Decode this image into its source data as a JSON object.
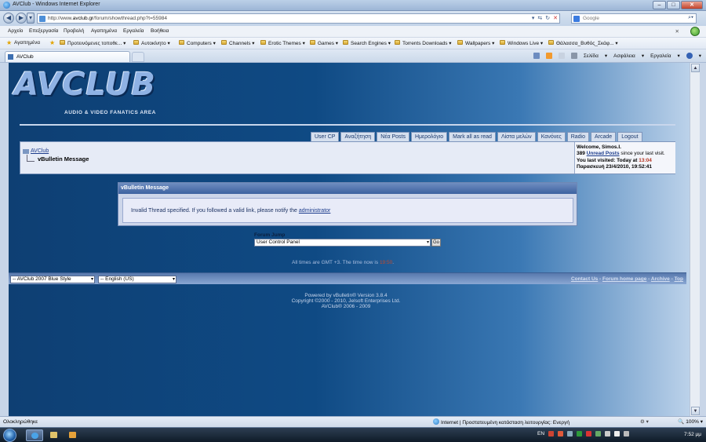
{
  "window": {
    "title": "AVClub - Windows Internet Explorer"
  },
  "address": {
    "url_prefix": "http://www.",
    "url_host": "avclub.gr",
    "url_path": "/forum/showthread.php?t=55984"
  },
  "search": {
    "placeholder": "Google"
  },
  "menubar": {
    "items": [
      "Αρχείο",
      "Επεξεργασία",
      "Προβολή",
      "Αγαπημένα",
      "Εργαλεία",
      "Βοήθεια"
    ]
  },
  "favorites": {
    "label": "Αγαπημένα",
    "items": [
      "Προτεινόμενες τοποθε...",
      "Αυτοκίνητο",
      "Computers",
      "Channels",
      "Erotic Themes",
      "Games",
      "Search Engines",
      "Torrents Downloads",
      "Wallpapers",
      "Windows Live",
      "Θάλασσα_Βυθός_Σκάφ..."
    ]
  },
  "tab": {
    "title": "AVClub"
  },
  "commandbar": {
    "page": "Σελίδα",
    "safety": "Ασφάλεια",
    "tools": "Εργαλεία"
  },
  "site": {
    "logo_text": "AVCLUB",
    "logo_subtitle": "AUDIO & VIDEO FANATICS AREA",
    "nav_tabs": [
      "User CP",
      "Αναζήτηση",
      "Νέα Posts",
      "Ημερολόγιο",
      "Mark all as read",
      "Λίστα μελών",
      "Κανόνες",
      "Radio",
      "Arcade",
      "Logout"
    ],
    "breadcrumb": {
      "home": "AVClub",
      "current": "vBulletin Message"
    },
    "welcome": {
      "line1": "Welcome, Simos.I.",
      "unread_count": "389",
      "unread_link": "Unread Posts",
      "unread_suffix": "since your last visit.",
      "last_visited_label": "You last visited: Today at",
      "last_visited_time": "13:04",
      "date": "Παρασκευή 23/4/2010, 19:52:41"
    },
    "message": {
      "header": "vBulletin Message",
      "text": "Invalid Thread specified. If you followed a valid link, please notify the",
      "link": "administrator"
    },
    "forum_jump": {
      "label": "Forum Jump",
      "selected": "User Control Panel",
      "go": "Go"
    },
    "timezone": {
      "text": "All times are GMT +3. The time now is",
      "now": "19:50",
      "end": "."
    },
    "footer": {
      "style_select": "-- AVClub 2007 Blue Style",
      "lang_select": "-- English (US)",
      "links": [
        "Contact Us",
        "Forum home page",
        "Archive",
        "Top"
      ]
    },
    "powered": [
      "Powered by vBulletin® Version 3.8.4",
      "Copyright ©2000 - 2010, Jelsoft Enterprises Ltd.",
      "AVClub® 2006 - 2009"
    ]
  },
  "status": {
    "left": "Ολοκληρώθηκε",
    "zone": "Internet | Προστατευμένη κατάσταση λειτουργίας: Ενεργή",
    "zoom": "100%"
  },
  "taskbar": {
    "lang": "EN",
    "clock": "7:52 μμ"
  }
}
